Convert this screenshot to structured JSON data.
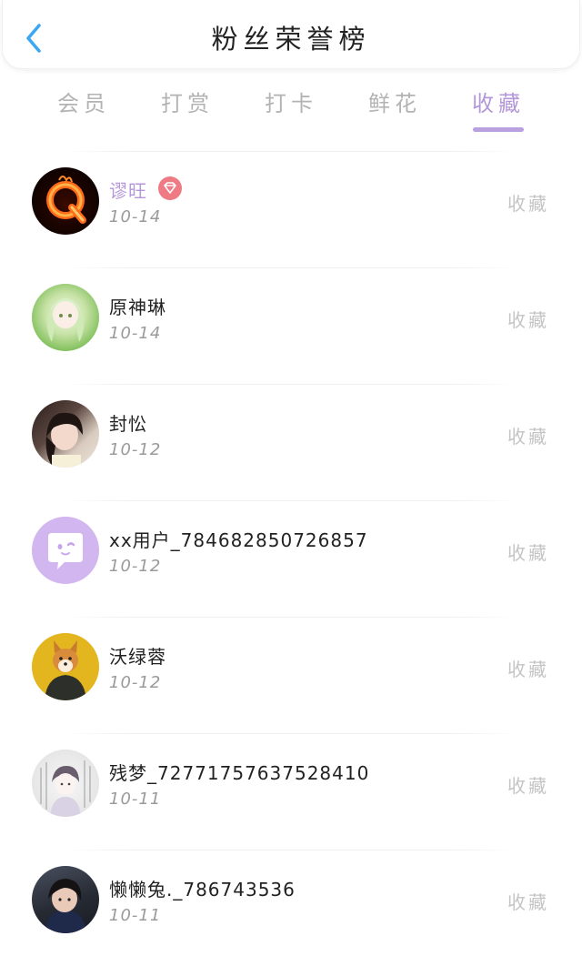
{
  "header": {
    "title": "粉丝荣誉榜",
    "back_icon": "chevron-left-icon",
    "accent": "#3ba6f2"
  },
  "tabs": [
    {
      "label": "会员",
      "active": false
    },
    {
      "label": "打赏",
      "active": false
    },
    {
      "label": "打卡",
      "active": false
    },
    {
      "label": "鲜花",
      "active": false
    },
    {
      "label": "收藏",
      "active": true
    }
  ],
  "colors": {
    "active_tab": "#b497d9",
    "vip_name": "#b497d9",
    "badge": "#ee7a84"
  },
  "fans": [
    {
      "name": "谬旺",
      "date": "10-14",
      "action": "收藏",
      "vip": true,
      "badge_icon": "diamond-icon"
    },
    {
      "name": "原神琳",
      "date": "10-14",
      "action": "收藏",
      "vip": false
    },
    {
      "name": "封忪",
      "date": "10-12",
      "action": "收藏",
      "vip": false
    },
    {
      "name": "xx用户_784682850726857",
      "date": "10-12",
      "action": "收藏",
      "vip": false,
      "avatar_icon": "chat-bubble-icon"
    },
    {
      "name": "沃绿蓉",
      "date": "10-12",
      "action": "收藏",
      "vip": false
    },
    {
      "name": "残梦_72771757637528410",
      "date": "10-11",
      "action": "收藏",
      "vip": false
    },
    {
      "name": "懒懒兔._786743536",
      "date": "10-11",
      "action": "收藏",
      "vip": false
    }
  ]
}
